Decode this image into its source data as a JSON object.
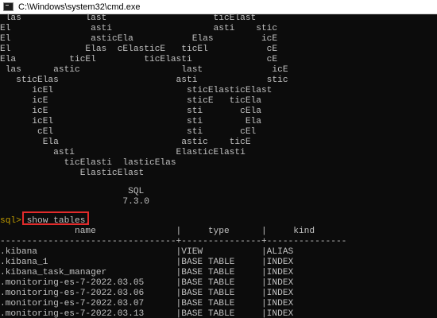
{
  "window": {
    "title": "C:\\Windows\\system32\\cmd.exe",
    "icon": "cmd-icon"
  },
  "banner": [
    " las            last                    ticElast",
    "El               asti                   asti    stic",
    "El               asticEla           Elas         icE",
    "El              Elas  cElasticE   ticEl           cE",
    "Ela          ticEl         ticElasti              cE",
    " las      astic                   last             icE",
    "   sticElas                      asti             stic",
    "      icEl                         sticElasticElast",
    "      icE                          sticE   ticEla",
    "      icE                          sti       cEla",
    "      icEl                         sti        Ela",
    "       cEl                         sti       cEl",
    "        Ela                       astic    ticE",
    "          asti                   ElasticElasti",
    "            ticElasti  lasticElas",
    "               ElasticElast",
    "",
    "                        SQL",
    "                       7.3.0"
  ],
  "prompt": {
    "label": "sql>",
    "command": " show tables;"
  },
  "table": {
    "header_line": "              name               |     type      |     kind",
    "separator": "---------------------------------+---------------+---------------",
    "rows": [
      ".kibana                          |VIEW           |ALIAS",
      ".kibana_1                        |BASE TABLE     |INDEX",
      ".kibana_task_manager             |BASE TABLE     |INDEX",
      ".monitoring-es-7-2022.03.05      |BASE TABLE     |INDEX",
      ".monitoring-es-7-2022.03.06      |BASE TABLE     |INDEX",
      ".monitoring-es-7-2022.03.07      |BASE TABLE     |INDEX",
      ".monitoring-es-7-2022.03.13      |BASE TABLE     |INDEX"
    ]
  },
  "colors": {
    "background": "#0c0c0c",
    "text": "#c0c0c0",
    "prompt": "#c19c00",
    "highlight": "#e22b2b"
  }
}
